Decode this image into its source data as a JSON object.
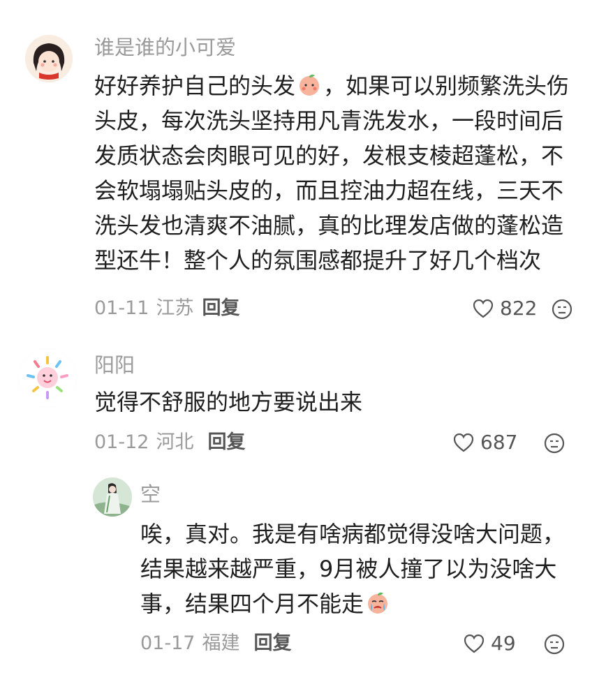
{
  "comments": [
    {
      "username": "谁是谁的小可爱",
      "content_lines": [
        "好好养护自己的头发",
        "，如果可以别频繁洗头伤",
        "头皮，每次洗头坚持用凡青洗发水，一段时间后",
        "发质状态会肉眼可见的好，发根支棱超蓬松，不",
        "会软塌塌贴头皮的，而且控油力超在线，三天不",
        "洗头发也清爽不油腻，真的比理发店做的蓬松造",
        "型还牛！整个人的氛围感都提升了好几个档次"
      ],
      "date": "01-11",
      "location": "江苏",
      "reply_label": "回复",
      "likes": "822"
    },
    {
      "username": "阳阳",
      "content_lines": [
        "觉得不舒服的地方要说出来"
      ],
      "date": "01-12",
      "location": "河北",
      "reply_label": "回复",
      "likes": "687"
    },
    {
      "username": "空",
      "content_lines": [
        "唉，真对。我是有啥病都觉得没啥大问题，",
        "结果越来越严重，9月被人撞了以为没啥大",
        "事，结果四个月不能走"
      ],
      "date": "01-17",
      "location": "福建",
      "reply_label": "回复",
      "likes": "49"
    }
  ],
  "icons": {
    "like": "heart-outline-icon",
    "dislike": "unhappy-face-icon",
    "emoji_1": "peach-blush-emoji",
    "emoji_2": "crying-face-emoji"
  },
  "colors": {
    "username": "#9a9a9a",
    "text": "#1f1f1f",
    "meta": "#9a9a9a",
    "reply": "#555555"
  }
}
